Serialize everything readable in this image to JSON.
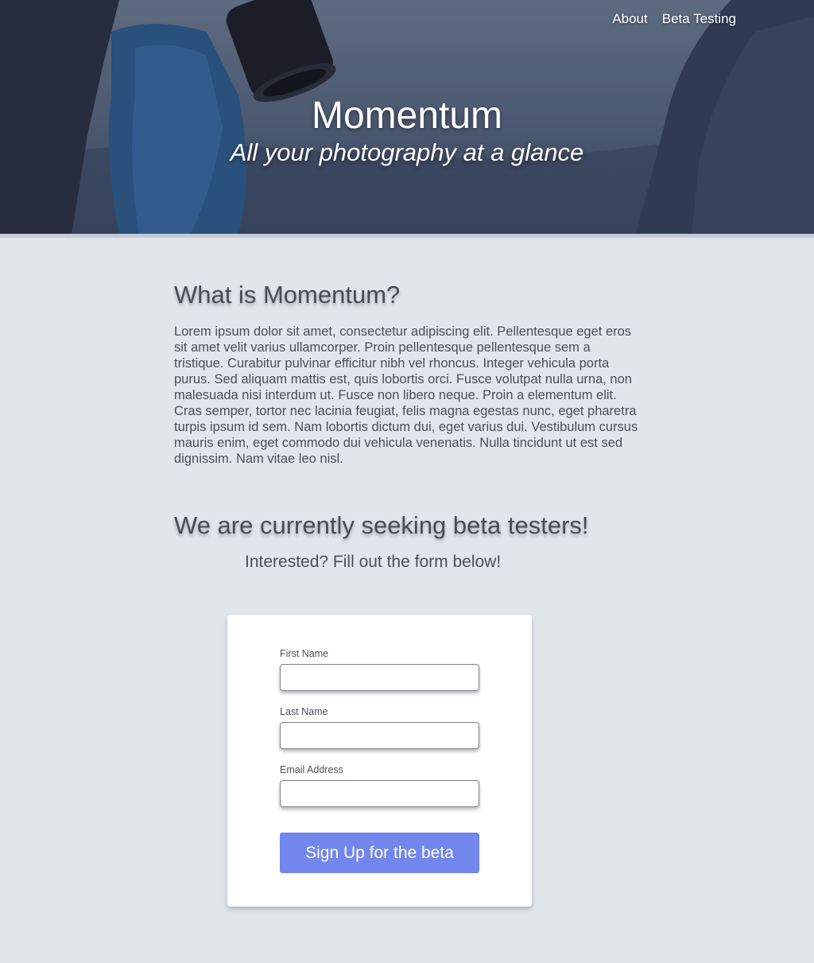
{
  "nav": {
    "links": [
      {
        "label": "About"
      },
      {
        "label": "Beta Testing"
      }
    ]
  },
  "hero": {
    "title": "Momentum",
    "subtitle": "All your photography at a glance"
  },
  "about": {
    "heading": "What is Momentum?",
    "body": "Lorem ipsum dolor sit amet, consectetur adipiscing elit. Pellentesque eget eros sit amet velit varius ullamcorper. Proin pellentesque pellentesque sem a tristique. Curabitur pulvinar efficitur nibh vel rhoncus. Integer vehicula porta purus. Sed aliquam mattis est, quis lobortis orci. Fusce volutpat nulla urna, non malesuada nisi interdum ut. Fusce non libero neque. Proin a elementum elit. Cras semper, tortor nec lacinia feugiat, felis magna egestas nunc, eget pharetra turpis ipsum id sem. Nam lobortis dictum dui, eget varius dui. Vestibulum cursus mauris enim, eget commodo dui vehicula venenatis. Nulla tincidunt ut est sed dignissim. Nam vitae leo nisl."
  },
  "beta": {
    "heading": "We are currently seeking beta testers!",
    "subheading": "Interested? Fill out the form below!"
  },
  "form": {
    "first_name": {
      "label": "First Name",
      "value": "",
      "placeholder": ""
    },
    "last_name": {
      "label": "Last Name",
      "value": "",
      "placeholder": ""
    },
    "email": {
      "label": "Email Address",
      "value": "",
      "placeholder": ""
    },
    "submit_label": "Sign Up for the beta"
  },
  "colors": {
    "page_background": "#e1e6eb",
    "accent_button": "#7286ee",
    "card_background": "#ffffff",
    "hero_divider": "#c4cbd6"
  }
}
